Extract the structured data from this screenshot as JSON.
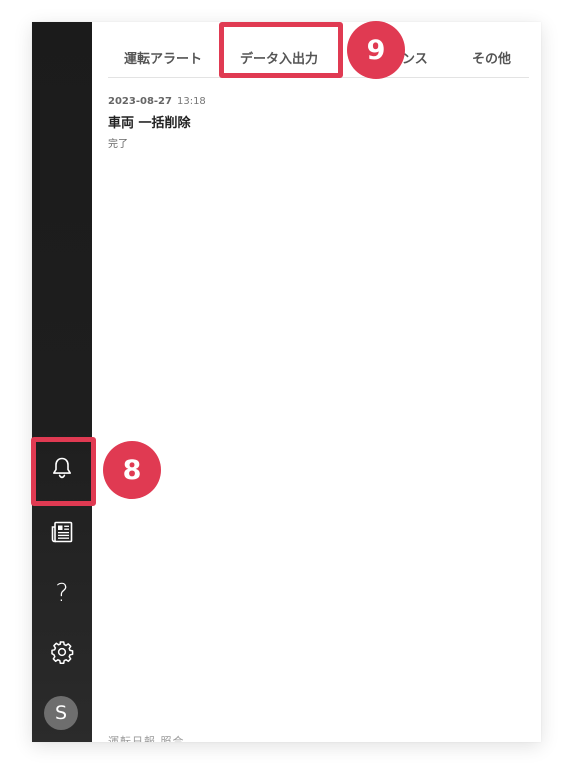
{
  "tabs": [
    {
      "label": "運転アラート"
    },
    {
      "label": "データ入出力"
    },
    {
      "label": "ンス"
    },
    {
      "label": "その他"
    }
  ],
  "notifications": [
    {
      "date": "2023-08-27",
      "time": "13:18",
      "title": "車両 一括削除",
      "status": "完了"
    }
  ],
  "truncated_item_text": "運転日報 照合",
  "sidebar": {
    "items": [
      {
        "icon": "bell-icon"
      },
      {
        "icon": "news-icon"
      },
      {
        "icon": "help-icon",
        "label": "?"
      },
      {
        "icon": "gear-icon"
      }
    ],
    "avatar_initial": "S"
  },
  "callouts": [
    {
      "number": "8"
    },
    {
      "number": "9"
    }
  ],
  "colors": {
    "highlight": "#e03a52",
    "sidebar_bg": "#1e1e1e"
  }
}
